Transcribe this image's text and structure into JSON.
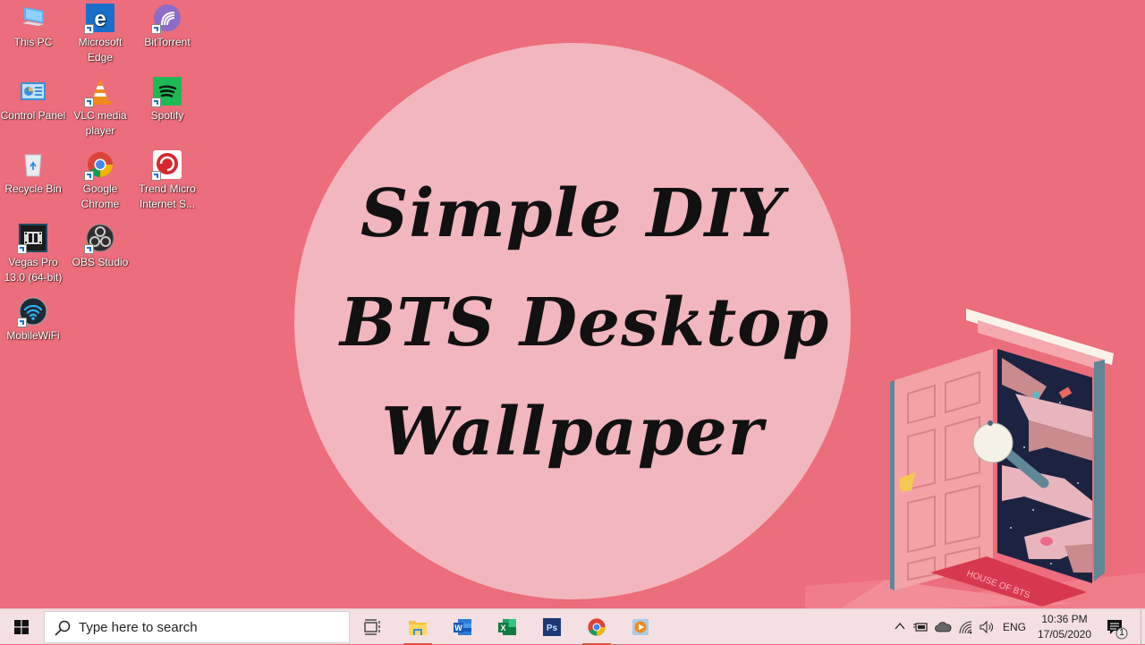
{
  "wallpaper": {
    "title_lines": [
      "Simple DIY",
      "BTS Desktop",
      "Wallpaper"
    ],
    "doormat_text": "HOUSE OF BTS",
    "colors": {
      "background": "#ec6d7b",
      "circle": "#f2b6be",
      "door": "#f3a2a6",
      "space": "#1c2340",
      "doormat": "#d8384f"
    }
  },
  "desktop_icons": [
    {
      "label": "This PC",
      "icon": "computer-icon",
      "shortcut": false
    },
    {
      "label": "Microsoft Edge",
      "icon": "edge-icon",
      "shortcut": true
    },
    {
      "label": "BitTorrent",
      "icon": "bittorrent-icon",
      "shortcut": true
    },
    {
      "label": "Control Panel",
      "icon": "control-panel-icon",
      "shortcut": false
    },
    {
      "label": "VLC media player",
      "icon": "vlc-icon",
      "shortcut": true
    },
    {
      "label": "Spotify",
      "icon": "spotify-icon",
      "shortcut": true
    },
    {
      "label": "Recycle Bin",
      "icon": "recycle-bin-icon",
      "shortcut": false
    },
    {
      "label": "Google Chrome",
      "icon": "chrome-icon",
      "shortcut": true
    },
    {
      "label": "Trend Micro Internet S...",
      "icon": "trend-micro-icon",
      "shortcut": true
    },
    {
      "label": "Vegas Pro 13.0 (64-bit)",
      "icon": "vegas-pro-icon",
      "shortcut": true
    },
    {
      "label": "OBS Studio",
      "icon": "obs-icon",
      "shortcut": true
    },
    {
      "label": "MobileWiFi",
      "icon": "mobile-wifi-icon",
      "shortcut": true
    }
  ],
  "taskbar": {
    "search_placeholder": "Type here to search",
    "pinned": [
      {
        "name": "File Explorer",
        "icon": "file-explorer-icon",
        "running": true
      },
      {
        "name": "Microsoft Word",
        "icon": "word-icon",
        "running": false
      },
      {
        "name": "Microsoft Excel",
        "icon": "excel-icon",
        "running": false
      },
      {
        "name": "Adobe Photoshop",
        "icon": "photoshop-icon",
        "running": false
      },
      {
        "name": "Google Chrome",
        "icon": "chrome-icon",
        "running": true
      },
      {
        "name": "Media Player",
        "icon": "media-player-icon",
        "running": false
      }
    ],
    "tray": {
      "language": "ENG",
      "time": "10:36 PM",
      "date": "17/05/2020",
      "notification_count": "1"
    }
  }
}
